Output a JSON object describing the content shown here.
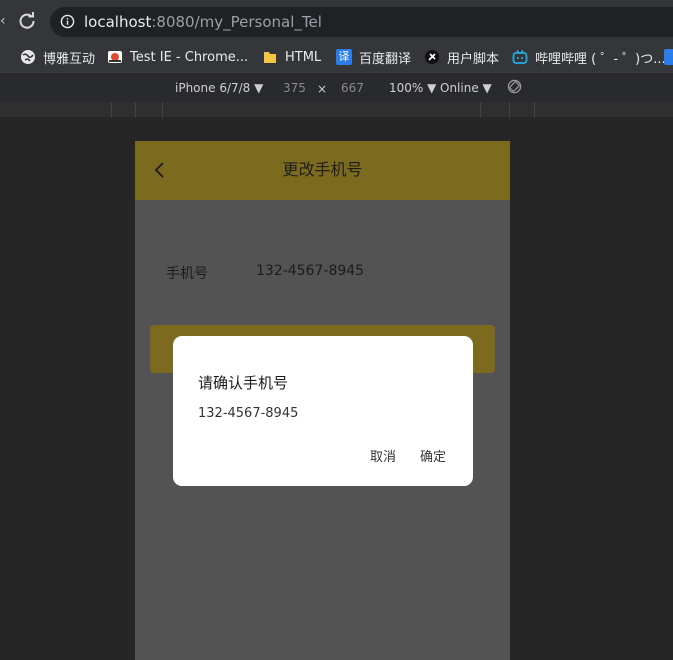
{
  "browser": {
    "url_host": "localhost",
    "url_path": ":8080/my_Personal_Tel"
  },
  "bookmarks": [
    {
      "label": "博雅互动",
      "icon": "globe-icon",
      "color": "#ffffff"
    },
    {
      "label": "Test IE - Chrome...",
      "icon": "ie-tab-icon",
      "color": "#e24a2d"
    },
    {
      "label": "HTML",
      "icon": "folder-icon",
      "color": "#f4c542"
    },
    {
      "label": "百度翻译",
      "icon": "translate-icon",
      "color": "#2b7de9"
    },
    {
      "label": "用户脚本",
      "icon": "script-icon",
      "color": "#ffffff"
    },
    {
      "label": "哔哩哔哩 ( ゜- ゜)つ...",
      "icon": "bilibili-icon",
      "color": "#23ade5"
    }
  ],
  "devtools": {
    "device": "iPhone 6/7/8",
    "width": "375",
    "times": "×",
    "height": "667",
    "zoom": "100%",
    "network": "Online"
  },
  "page": {
    "title": "更改手机号",
    "phone_label": "手机号",
    "phone_value": "132-4567-8945"
  },
  "dialog": {
    "title": "请确认手机号",
    "phone": "132-4567-8945",
    "cancel": "取消",
    "confirm": "确定"
  },
  "colors": {
    "accent": "#f1d13d",
    "accent_dimmed": "#7c6a1f",
    "page_bg_dimmed": "#535353"
  }
}
